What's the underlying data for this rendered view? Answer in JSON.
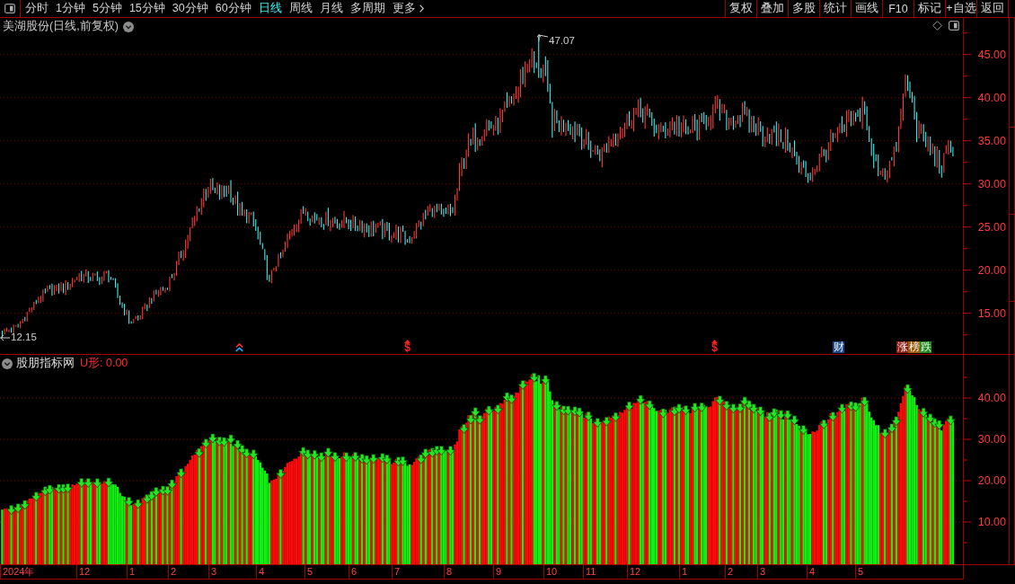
{
  "toolbar": {
    "tabs": [
      {
        "label": "分时",
        "selected": false
      },
      {
        "label": "1分钟",
        "selected": false
      },
      {
        "label": "5分钟",
        "selected": false
      },
      {
        "label": "15分钟",
        "selected": false
      },
      {
        "label": "30分钟",
        "selected": false
      },
      {
        "label": "60分钟",
        "selected": false
      },
      {
        "label": "日线",
        "selected": true
      },
      {
        "label": "周线",
        "selected": false
      },
      {
        "label": "月线",
        "selected": false
      },
      {
        "label": "多周期",
        "selected": false
      }
    ],
    "more_button": {
      "label": "更多"
    },
    "buttons": [
      "复权",
      "叠加",
      "多股",
      "统计",
      "画线",
      "F10",
      "标记",
      "+自选",
      "返回"
    ]
  },
  "price_pane": {
    "title": "美湖股份(日线,前复权)",
    "high_label": "47.07",
    "low_label": "12.15",
    "markers": [
      {
        "kind": "arrows"
      },
      {
        "kind": "dollar",
        "text": "$"
      },
      {
        "kind": "dollar",
        "text": "$"
      },
      {
        "kind": "tags",
        "tags": [
          {
            "text": "财",
            "color": "#1d4a8c"
          }
        ]
      },
      {
        "kind": "tags",
        "tags": [
          {
            "text": "涨",
            "color": "#8c1c10"
          },
          {
            "text": "榜",
            "color": "#9c5c0c"
          },
          {
            "text": "跌",
            "color": "#1c8c1c"
          }
        ]
      }
    ],
    "axis_labels": [
      "45.00",
      "40.00",
      "35.00",
      "30.00",
      "25.00",
      "20.00",
      "15.00"
    ]
  },
  "indicator_pane": {
    "title": "股朋指标网",
    "reading": "U形: 0.00",
    "axis_labels": [
      "40.00",
      "30.00",
      "20.00",
      "10.00"
    ]
  },
  "date_axis": [
    "2024年",
    "12",
    "1",
    "2",
    "3",
    "4",
    "5",
    "6",
    "7",
    "8",
    "9",
    "10",
    "11",
    "12",
    "1",
    "2",
    "3",
    "4",
    "5"
  ]
}
